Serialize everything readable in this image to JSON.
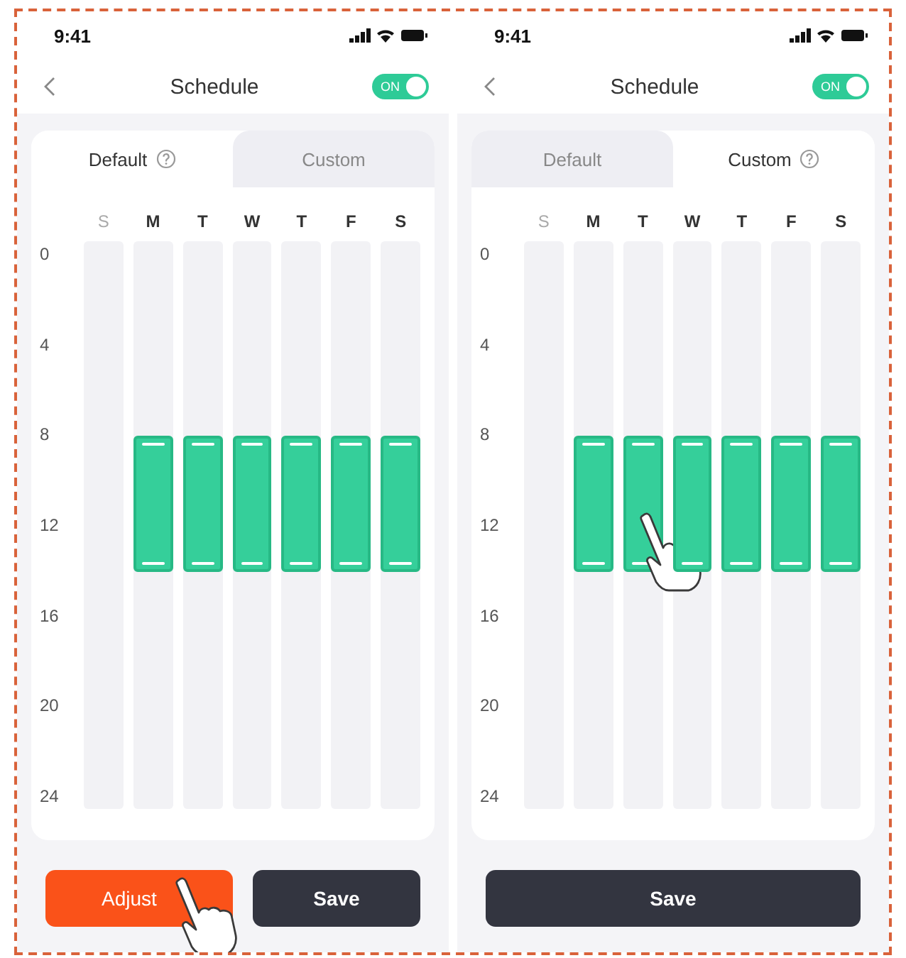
{
  "screens": [
    {
      "status_bar": {
        "time": "9:41"
      },
      "header": {
        "title": "Schedule",
        "toggle": {
          "label": "ON",
          "on": true
        }
      },
      "tabs": [
        {
          "label": "Default",
          "selected": true,
          "help": true
        },
        {
          "label": "Custom",
          "selected": false,
          "help": false
        }
      ],
      "days": [
        {
          "label": "S",
          "disabled": true,
          "scheduled": false
        },
        {
          "label": "M",
          "disabled": false,
          "scheduled": true
        },
        {
          "label": "T",
          "disabled": false,
          "scheduled": true
        },
        {
          "label": "W",
          "disabled": false,
          "scheduled": true
        },
        {
          "label": "T",
          "disabled": false,
          "scheduled": true
        },
        {
          "label": "F",
          "disabled": false,
          "scheduled": true
        },
        {
          "label": "S",
          "disabled": false,
          "scheduled": true
        }
      ],
      "hours": [
        "0",
        "4",
        "8",
        "12",
        "16",
        "20",
        "24"
      ],
      "buttons": [
        {
          "label": "Adjust",
          "kind": "primary"
        },
        {
          "label": "Save",
          "kind": "dark"
        }
      ],
      "pointer": {
        "kind": "button"
      }
    },
    {
      "status_bar": {
        "time": "9:41"
      },
      "header": {
        "title": "Schedule",
        "toggle": {
          "label": "ON",
          "on": true
        }
      },
      "tabs": [
        {
          "label": "Default",
          "selected": false,
          "help": false
        },
        {
          "label": "Custom",
          "selected": true,
          "help": true
        }
      ],
      "days": [
        {
          "label": "S",
          "disabled": true,
          "scheduled": false
        },
        {
          "label": "M",
          "disabled": false,
          "scheduled": true
        },
        {
          "label": "T",
          "disabled": false,
          "scheduled": true
        },
        {
          "label": "W",
          "disabled": false,
          "scheduled": true
        },
        {
          "label": "T",
          "disabled": false,
          "scheduled": true
        },
        {
          "label": "F",
          "disabled": false,
          "scheduled": true
        },
        {
          "label": "S",
          "disabled": false,
          "scheduled": true
        }
      ],
      "hours": [
        "0",
        "4",
        "8",
        "12",
        "16",
        "20",
        "24"
      ],
      "buttons": [
        {
          "label": "Save",
          "kind": "dark"
        }
      ],
      "pointer": {
        "kind": "day"
      }
    }
  ]
}
